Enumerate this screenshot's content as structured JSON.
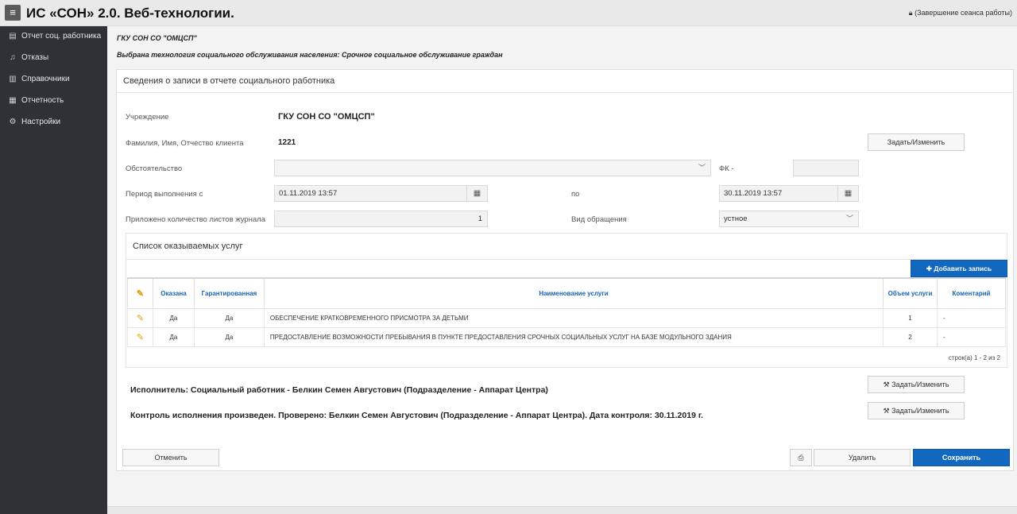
{
  "header": {
    "app_title": "ИС «СОН» 2.0. Веб-технологии.",
    "logout": "(Завершение сеанса работы)"
  },
  "sidebar": {
    "items": [
      {
        "icon": "address-card-icon",
        "glyph": "▤",
        "label": "Отчет соц. работника"
      },
      {
        "icon": "bell-icon",
        "glyph": "♫",
        "label": "Отказы"
      },
      {
        "icon": "book-icon",
        "glyph": "▥",
        "label": "Справочники"
      },
      {
        "icon": "table-icon",
        "glyph": "▦",
        "label": "Отчетность"
      },
      {
        "icon": "gears-icon",
        "glyph": "⚙",
        "label": "Настройки"
      }
    ]
  },
  "main": {
    "org_name": "ГКУ СОН СО \"ОМЦСП\"",
    "technology_line": "Выбрана технология социального обслуживания населения: Срочное социальное обслуживание граждан"
  },
  "panel": {
    "title": "Сведения о записи в отчете социального работника",
    "institution_label": "Учреждение",
    "institution_value": "ГКУ СОН СО \"ОМЦСП\"",
    "client_label": "Фамилия, Имя, Отчество клиента",
    "client_value": "1221",
    "client_button": "Задать/Изменить",
    "circumstance_label": "Обстоятельство",
    "circumstance_value": "",
    "fk_label": "ФК -",
    "fk_value": "",
    "period_label": "Период выполнения с",
    "period_from": "01.11.2019 13:57",
    "period_to_label": "по",
    "period_to": "30.11.2019 13:57",
    "sheets_label": "Приложено количество листов журнала",
    "sheets_value": "1",
    "appeal_label": "Вид обращения",
    "appeal_value": "устное"
  },
  "services": {
    "title": "Список оказываемых услуг",
    "add_button": "Добавить запись",
    "columns": [
      "Оказана",
      "Гарантированная",
      "Наименование услуги",
      "Объем услуги",
      "Коментарий"
    ],
    "rows": [
      {
        "provided": "Да",
        "guaranteed": "Да",
        "name": "ОБЕСПЕЧЕНИЕ КРАТКОВРЕМЕННОГО ПРИСМОТРА ЗА ДЕТЬМИ",
        "volume": "1",
        "comment": "-"
      },
      {
        "provided": "Да",
        "guaranteed": "Да",
        "name": "ПРЕДОСТАВЛЕНИЕ ВОЗМОЖНОСТИ ПРЕБЫВАНИЯ В ПУНКТЕ ПРЕДОСТАВЛЕНИЯ СРОЧНЫХ СОЦИАЛЬНЫХ УСЛУГ НА БАЗЕ МОДУЛЬНОГО ЗДАНИЯ",
        "volume": "2",
        "comment": "-"
      }
    ],
    "pager": "строк(а) 1 - 2 из 2"
  },
  "executor": {
    "text": "Исполнитель: Социальный работник - Белкин Семен Августович (Подразделение - Аппарат Центра)",
    "button": "Задать/Изменить"
  },
  "control": {
    "text": "Контроль исполнения произведен. Проверено: Белкин Семен Августович (Подразделение - Аппарат Центра). Дата контроля: 30.11.2019 г.",
    "button": "Задать/Изменить"
  },
  "footer": {
    "cancel": "Отменить",
    "delete": "Удалить",
    "save": "Сохранить"
  },
  "colors": {
    "primary": "#1267be",
    "sidebar": "#2f3136",
    "header_link": "#1a63b5"
  }
}
